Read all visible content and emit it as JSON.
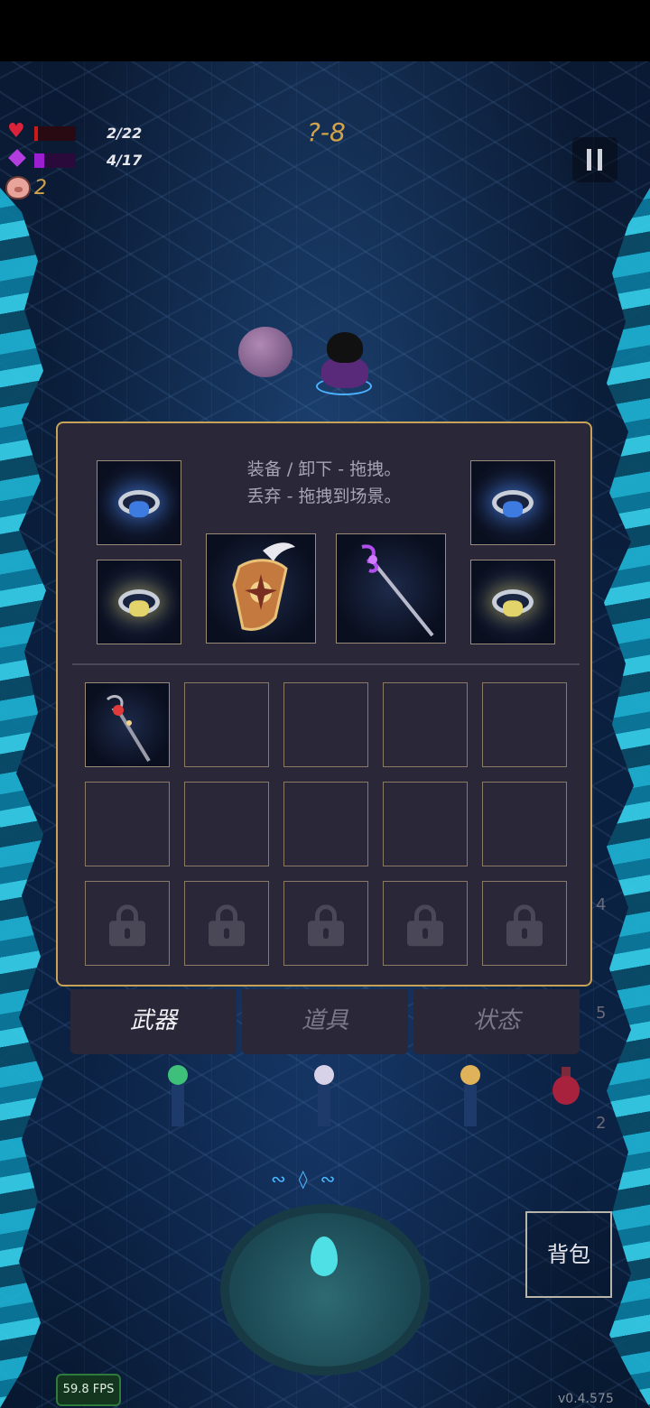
{
  "hud": {
    "hp_text": "2/22",
    "hp_fraction": 0.09,
    "mp_text": "4/17",
    "mp_fraction": 0.24,
    "stage": "?-8",
    "coins": "2",
    "icons": [
      "heart-icon",
      "mana-diamond-icon",
      "pig-coin-icon",
      "pause-icon"
    ]
  },
  "inventory": {
    "hint_line1": "装备 / 卸下 - 拖拽。",
    "hint_line2": "丢弃 - 拖拽到场景。",
    "equipped": {
      "ring_top_left": "blue-ring-icon",
      "ring_bottom_left": "gold-ring-icon",
      "shield": "winged-shield-icon",
      "staff": "purple-staff-icon",
      "ring_top_right": "blue-ring-icon",
      "ring_bottom_right": "gold-ring-icon"
    },
    "bag_items": [
      "red-orb-staff-icon"
    ],
    "unlocked_rows": 2,
    "locked_rows": 1,
    "columns": 5
  },
  "tabs": [
    {
      "label": "武器",
      "active": true
    },
    {
      "label": "道具",
      "active": false
    },
    {
      "label": "状态",
      "active": false
    }
  ],
  "side_numbers": {
    "a": "4",
    "b": "5",
    "c": "2"
  },
  "bag_button": "背包",
  "fps": "59.8 FPS",
  "version": "v0.4.575",
  "colors": {
    "accent": "#c8a256",
    "panel": "#2a2838",
    "hp": "#cc1a1a",
    "mp": "#9b1fd0",
    "stage": "#d2a34a"
  }
}
